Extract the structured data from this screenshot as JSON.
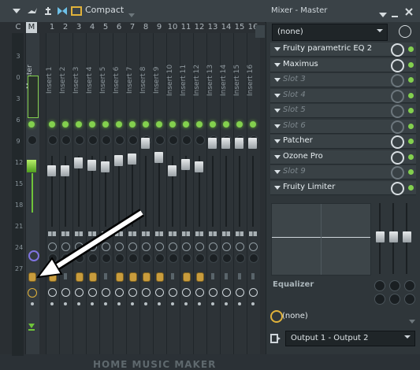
{
  "toolbar": {
    "mode_label": "Compact",
    "panel_title": "Mixer - Master"
  },
  "mixer": {
    "strip_headers": [
      "C",
      "M",
      "1",
      "2",
      "3",
      "4",
      "5",
      "6",
      "7",
      "8",
      "9",
      "10",
      "11",
      "12",
      "13",
      "14",
      "15",
      "16"
    ],
    "master_name": "Master",
    "insert_names": [
      "Insert 1",
      "Insert 2",
      "Insert 3",
      "Insert 4",
      "Insert 5",
      "Insert 6",
      "Insert 7",
      "Insert 8",
      "Insert 9",
      "Insert 10",
      "Insert 11",
      "Insert 12",
      "Insert 13",
      "Insert 14",
      "Insert 15",
      "Insert 16"
    ],
    "db_scale": [
      "3",
      "0",
      "3",
      "6",
      "9",
      "12",
      "15",
      "18",
      "21",
      "24",
      "27"
    ]
  },
  "right_panel": {
    "preset": "(none)",
    "slots": [
      {
        "label": "Fruity parametric EQ 2",
        "empty": false
      },
      {
        "label": "Maximus",
        "empty": false
      },
      {
        "label": "Slot 3",
        "empty": true
      },
      {
        "label": "Slot 4",
        "empty": true
      },
      {
        "label": "Slot 5",
        "empty": true
      },
      {
        "label": "Slot 6",
        "empty": true
      },
      {
        "label": "Patcher",
        "empty": false
      },
      {
        "label": "Ozone Pro",
        "empty": false
      },
      {
        "label": "Slot 9",
        "empty": true
      },
      {
        "label": "Fruity Limiter",
        "empty": false
      }
    ],
    "equalizer_label": "Equalizer",
    "bottom_preset": "(none)",
    "output": "Output 1 - Output 2"
  },
  "watermark": "HOME MUSIC MAKER",
  "colors": {
    "led_green": "#83d04e",
    "accent_yellow": "#e0b23a",
    "panel_bg": "#2f363a"
  }
}
